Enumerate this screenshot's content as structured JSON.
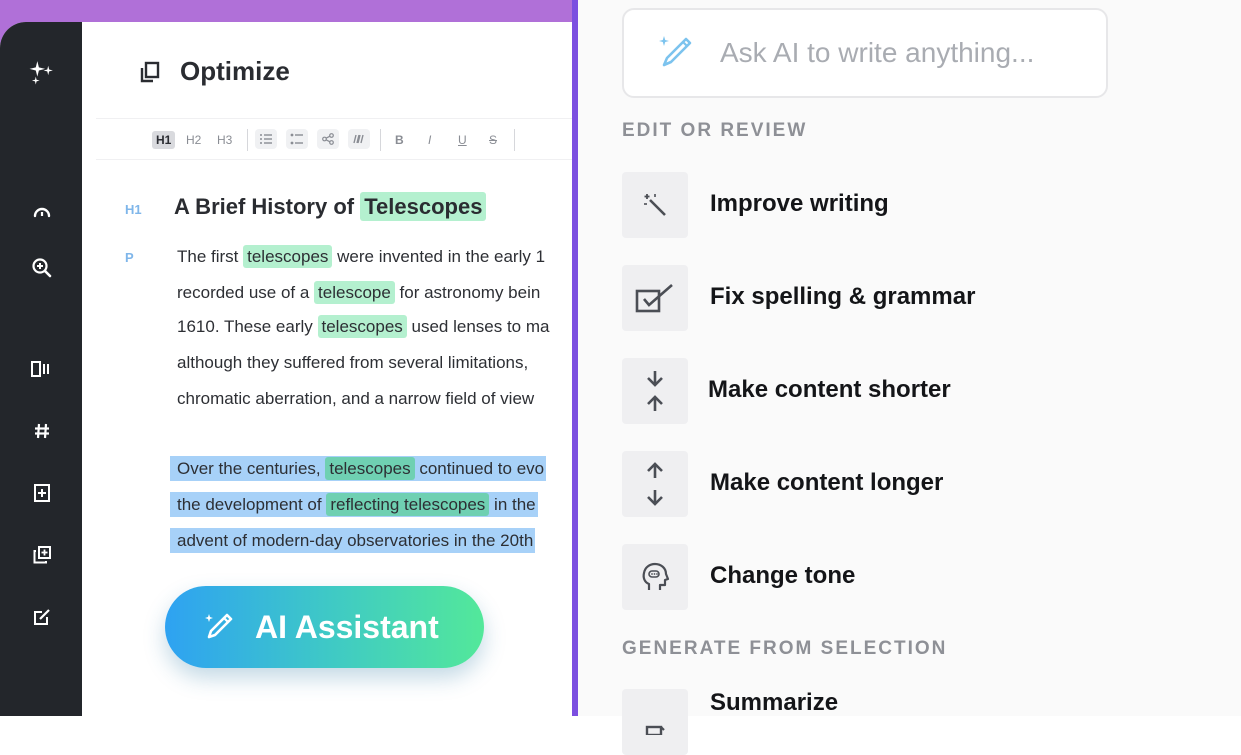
{
  "editor": {
    "doc_title": "Optimize",
    "toolbar": {
      "h1": "H1",
      "h2": "H2",
      "h3": "H3",
      "bold": "B",
      "italic": "I",
      "underline": "U",
      "strike": "S"
    },
    "heading_label": "H1",
    "para_label": "P",
    "heading": {
      "before": "A Brief History of ",
      "highlight": "Telescopes"
    },
    "paragraph1": {
      "line1": {
        "before": "The first ",
        "hl": "telescopes",
        "after": " were invented in the early 1"
      },
      "line2": {
        "before": "recorded use of a ",
        "hl": "telescope",
        "after": " for astronomy bein"
      },
      "line3": {
        "before": "1610. These early ",
        "hl": "telescopes",
        "after": " used lenses to ma"
      },
      "line4": "although they suffered from several limitations,",
      "line5": "chromatic aberration, and a narrow field of view"
    },
    "paragraph2": {
      "line1": {
        "before": "Over the centuries, ",
        "hl": "telescopes",
        "after": " continued to evo"
      },
      "line2": {
        "before": "the development of ",
        "hl": "reflecting telescopes",
        "after": " in the"
      },
      "line3": "advent of modern-day observatories in the 20th"
    },
    "ai_button": "AI Assistant"
  },
  "panel": {
    "prompt_placeholder": "Ask AI to write anything...",
    "section_edit": "EDIT OR REVIEW",
    "items": [
      {
        "label": "Improve writing",
        "icon": "magic-wand-icon"
      },
      {
        "label": "Fix spelling & grammar",
        "icon": "checkbox-icon"
      },
      {
        "label": "Make content shorter",
        "icon": "shorten-arrows-icon"
      },
      {
        "label": "Make content longer",
        "icon": "lengthen-arrows-icon"
      },
      {
        "label": "Change tone",
        "icon": "head-speech-icon"
      }
    ],
    "section_generate": "GENERATE FROM SELECTION",
    "summarize": "Summarize"
  },
  "colors": {
    "accent_purple": "#7c4fe0",
    "rail": "#23262b",
    "highlight": "#b4f0cf",
    "selection": "#a7d1f8"
  }
}
